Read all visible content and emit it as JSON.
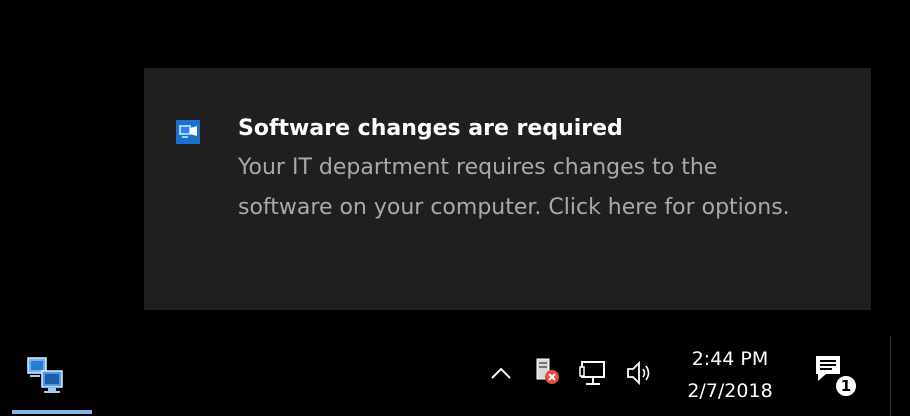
{
  "toast": {
    "app_icon": "software-center-icon",
    "title": "Software changes are required",
    "body": "Your IT department requires changes to the software on your computer. Click here for options."
  },
  "taskbar": {
    "app_icon": "computers-network-app-icon",
    "tray": {
      "chevron_icon": "chevron-up-icon",
      "pc_icon": "pc-with-error-icon",
      "network_icon": "network-icon",
      "volume_icon": "volume-icon"
    },
    "clock": {
      "time": "2:44 PM",
      "date": "2/7/2018"
    },
    "action_center": {
      "icon": "action-center-icon",
      "badge_count": "1"
    }
  },
  "colors": {
    "toast_background": "#1f1f1f",
    "toast_title": "#ffffff",
    "toast_body": "#a9a9a9",
    "taskbar_background": "#000000",
    "active_app_bar": "#7fb4e8"
  }
}
